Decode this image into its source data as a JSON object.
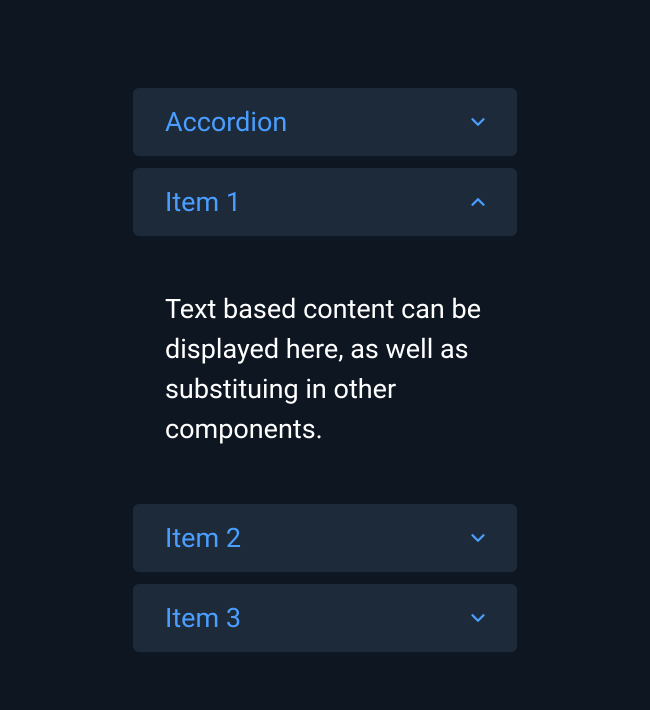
{
  "accordion": {
    "items": [
      {
        "label": "Accordion",
        "expanded": false
      },
      {
        "label": "Item 1",
        "expanded": true,
        "content": "Text based content can be displayed here, as well as substituing in other components."
      },
      {
        "label": "Item 2",
        "expanded": false
      },
      {
        "label": "Item 3",
        "expanded": false
      }
    ]
  }
}
